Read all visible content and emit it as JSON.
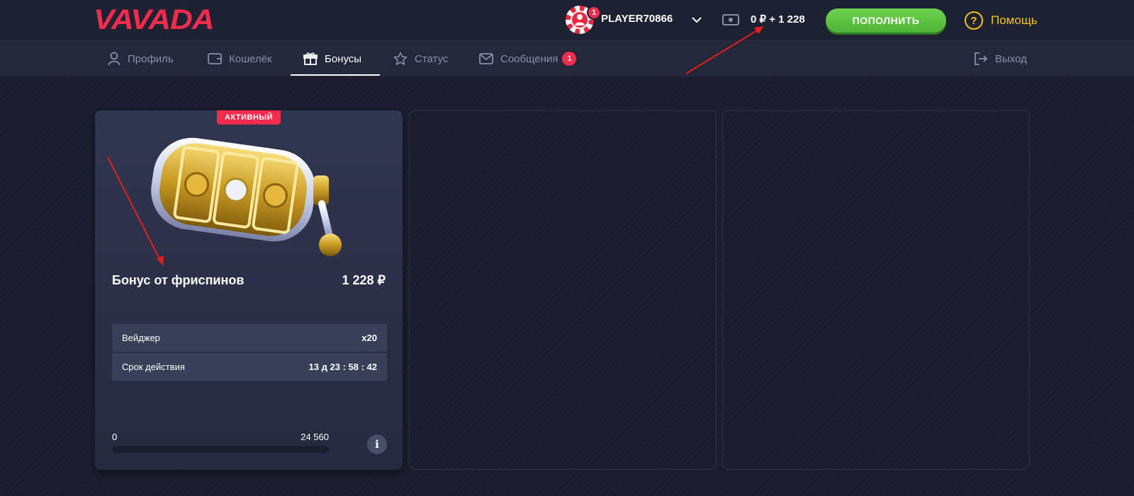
{
  "header": {
    "logo": "VAVADA",
    "avatar_badge": "1",
    "username": "PLAYER70866",
    "balance": "0 ₽ + 1 228",
    "deposit_label": "ПОПОЛНИТЬ",
    "help_label": "Помощь"
  },
  "nav": {
    "items": [
      {
        "label": "Профиль",
        "icon": "user-icon"
      },
      {
        "label": "Кошелёк",
        "icon": "wallet-icon"
      },
      {
        "label": "Бонусы",
        "icon": "gift-icon",
        "active": true
      },
      {
        "label": "Статус",
        "icon": "star-icon"
      },
      {
        "label": "Сообщения",
        "icon": "mail-icon",
        "badge": "1"
      }
    ],
    "logout_label": "Выход"
  },
  "bonus_card": {
    "status": "АКТИВНЫЙ",
    "title": "Бонус от фриспинов",
    "amount": "1 228 ₽",
    "rows": [
      {
        "label": "Вейджер",
        "value": "x20"
      },
      {
        "label": "Срок действия",
        "value": "13 д 23 : 58 : 42"
      }
    ],
    "progress_min": "0",
    "progress_max": "24 560",
    "progress_fraction": 0,
    "info_label": "i"
  },
  "colors": {
    "brand": "#f12c4c",
    "deposit": "#5bbf3f",
    "help": "#f0c419",
    "annotation_arrow": "#e01e1e"
  }
}
